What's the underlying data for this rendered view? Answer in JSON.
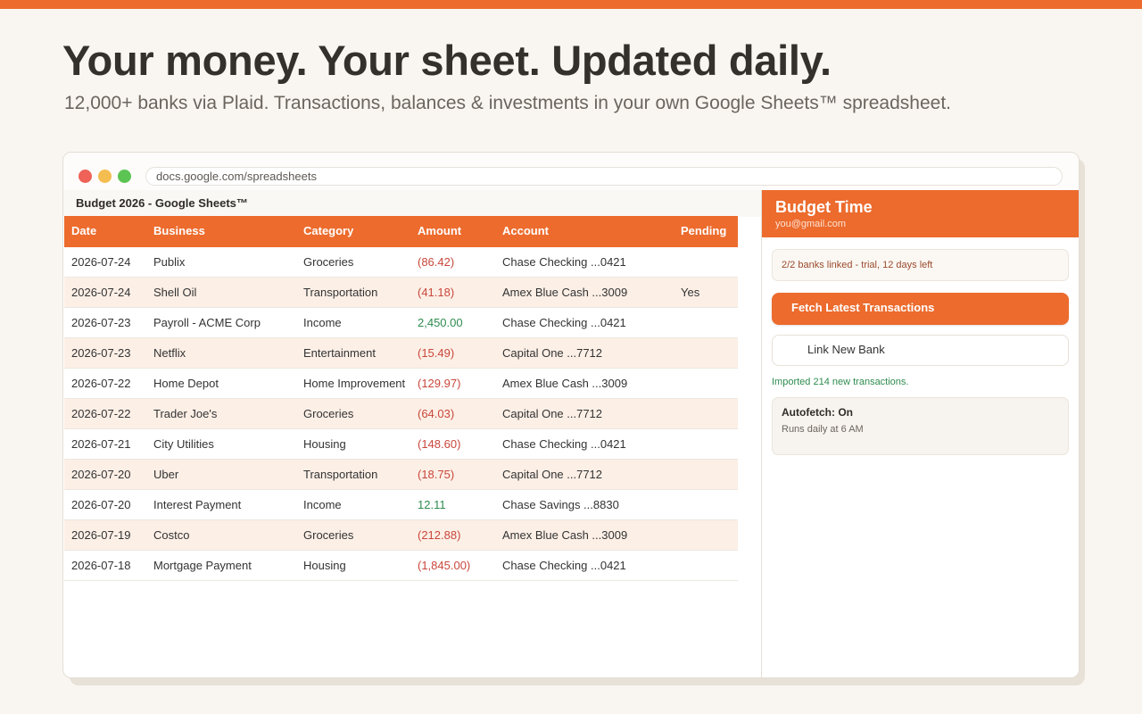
{
  "hero": {
    "headline": "Your money. Your sheet. Updated daily.",
    "subhead": "12,000+ banks via Plaid. Transactions, balances & investments in your own Google Sheets™ spreadsheet."
  },
  "browser": {
    "url": "docs.google.com/spreadsheets"
  },
  "sheet": {
    "title": "Budget 2026 - Google Sheets™",
    "columns": [
      "Date",
      "Business",
      "Category",
      "Amount",
      "Account",
      "Pending"
    ],
    "rows": [
      {
        "date": "2026-07-24",
        "business": "Publix",
        "category": "Groceries",
        "amount": "(86.42)",
        "amount_sign": "neg",
        "account": "Chase Checking ...0421",
        "pending": ""
      },
      {
        "date": "2026-07-24",
        "business": "Shell Oil",
        "category": "Transportation",
        "amount": "(41.18)",
        "amount_sign": "neg",
        "account": "Amex Blue Cash ...3009",
        "pending": "Yes"
      },
      {
        "date": "2026-07-23",
        "business": "Payroll - ACME Corp",
        "category": "Income",
        "amount": "2,450.00",
        "amount_sign": "pos",
        "account": "Chase Checking ...0421",
        "pending": ""
      },
      {
        "date": "2026-07-23",
        "business": "Netflix",
        "category": "Entertainment",
        "amount": "(15.49)",
        "amount_sign": "neg",
        "account": "Capital One ...7712",
        "pending": ""
      },
      {
        "date": "2026-07-22",
        "business": "Home Depot",
        "category": "Home Improvement",
        "amount": "(129.97)",
        "amount_sign": "neg",
        "account": "Amex Blue Cash ...3009",
        "pending": ""
      },
      {
        "date": "2026-07-22",
        "business": "Trader Joe's",
        "category": "Groceries",
        "amount": "(64.03)",
        "amount_sign": "neg",
        "account": "Capital One ...7712",
        "pending": ""
      },
      {
        "date": "2026-07-21",
        "business": "City Utilities",
        "category": "Housing",
        "amount": "(148.60)",
        "amount_sign": "neg",
        "account": "Chase Checking ...0421",
        "pending": ""
      },
      {
        "date": "2026-07-20",
        "business": "Uber",
        "category": "Transportation",
        "amount": "(18.75)",
        "amount_sign": "neg",
        "account": "Capital One ...7712",
        "pending": ""
      },
      {
        "date": "2026-07-20",
        "business": "Interest Payment",
        "category": "Income",
        "amount": "12.11",
        "amount_sign": "pos",
        "account": "Chase Savings ...8830",
        "pending": ""
      },
      {
        "date": "2026-07-19",
        "business": "Costco",
        "category": "Groceries",
        "amount": "(212.88)",
        "amount_sign": "neg",
        "account": "Amex Blue Cash ...3009",
        "pending": ""
      },
      {
        "date": "2026-07-18",
        "business": "Mortgage Payment",
        "category": "Housing",
        "amount": "(1,845.00)",
        "amount_sign": "neg",
        "account": "Chase Checking ...0421",
        "pending": ""
      }
    ]
  },
  "sidebar": {
    "title": "Budget Time",
    "email": "you@gmail.com",
    "status": "2/2 banks linked - trial, 12 days left",
    "fetch_label": "Fetch Latest Transactions",
    "link_label": "Link New Bank",
    "import_message": "Imported 214 new transactions.",
    "autofetch_title": "Autofetch: On",
    "autofetch_sub": "Runs daily at 6 AM"
  },
  "colors": {
    "accent": "#ec6b2d",
    "negative": "#c9473b",
    "positive": "#2e8c4f",
    "row_alt": "#fcefe6"
  }
}
